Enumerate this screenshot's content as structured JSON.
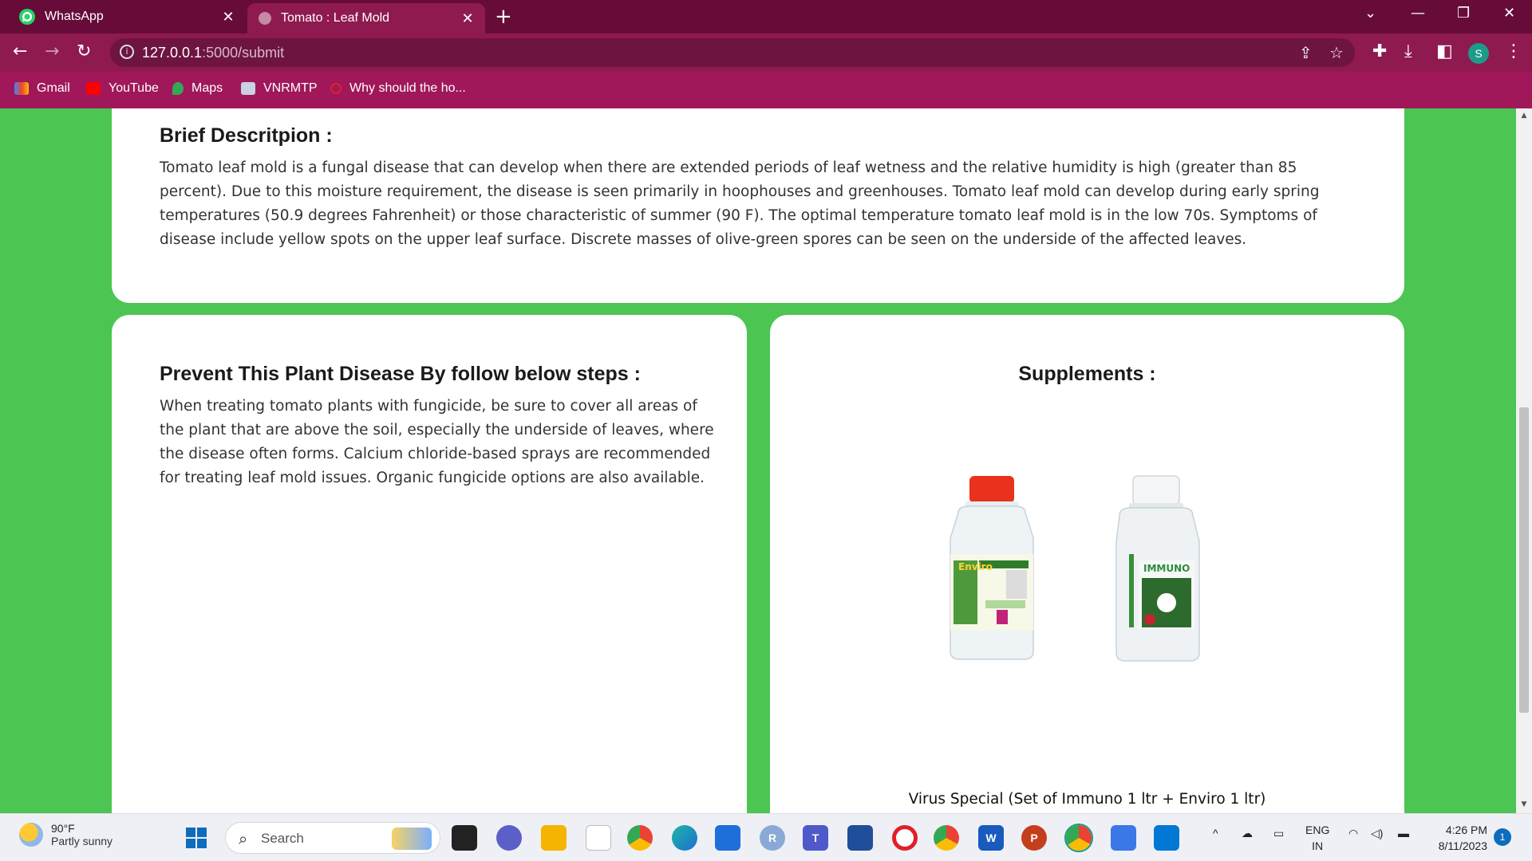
{
  "browser": {
    "tabs": [
      {
        "title": "WhatsApp",
        "active": false
      },
      {
        "title": "Tomato : Leaf Mold",
        "active": true
      }
    ],
    "url_host": "127.0.0.1",
    "url_path": ":5000/submit",
    "profile_initial": "S",
    "bookmarks": [
      "Gmail",
      "YouTube",
      "Maps",
      "VNRMTP",
      "Why should the ho..."
    ]
  },
  "page": {
    "description_heading": "Brief Descritpion :",
    "description_text": "Tomato leaf mold is a fungal disease that can develop when there are extended periods of leaf wetness and the relative humidity is high (greater than 85 percent). Due to this moisture requirement, the disease is seen primarily in hoophouses and greenhouses. Tomato leaf mold can develop during early spring temperatures (50.9 degrees Fahrenheit) or those characteristic of summer (90 F). The optimal temperature tomato leaf mold is in the low 70s. Symptoms of disease include yellow spots on the upper leaf surface. Discrete masses of olive-green spores can be seen on the underside of the affected leaves.",
    "prevent_heading": "Prevent This Plant Disease By follow below steps :",
    "prevent_text": "When treating tomato plants with fungicide, be sure to cover all areas of the plant that are above the soil, especially the underside of leaves, where the disease often forms. Calcium chloride-based sprays are recommended for treating leaf mold issues. Organic fungicide options are also available.",
    "supplements_heading": "Supplements :",
    "product_labels": [
      "Enviro",
      "IMMUNO"
    ],
    "product_name": "Virus Special (Set of Immuno 1 ltr + Enviro 1 ltr)"
  },
  "taskbar": {
    "weather_temp": "90°F",
    "weather_condition": "Partly sunny",
    "search_placeholder": "Search",
    "language": "ENG",
    "region": "IN",
    "time": "4:26 PM",
    "date": "8/11/2023",
    "notification_count": "1"
  },
  "colors": {
    "page_background": "#4cc552",
    "tab_strip": "#670c39",
    "toolbar": "#8f1a50",
    "bookmark_bar": "#a0185a"
  }
}
